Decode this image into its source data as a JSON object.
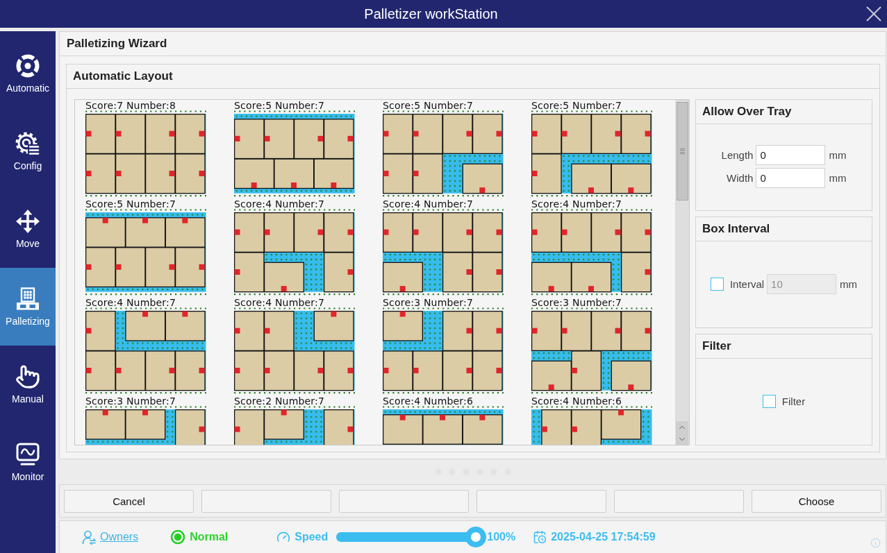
{
  "window": {
    "title": "Palletizer workStation"
  },
  "sidebar": {
    "items": [
      {
        "label": "Automatic",
        "selected": false
      },
      {
        "label": "Config",
        "selected": false
      },
      {
        "label": "Move",
        "selected": false
      },
      {
        "label": "Palletizing",
        "selected": true
      },
      {
        "label": "Manual",
        "selected": false
      },
      {
        "label": "Monitor",
        "selected": false
      }
    ]
  },
  "wizard": {
    "title": "Palletizing Wizard",
    "section": "Automatic Layout",
    "layouts": [
      {
        "label": "Score:7 Number:8"
      },
      {
        "label": "Score:5 Number:7"
      },
      {
        "label": "Score:5 Number:7"
      },
      {
        "label": "Score:5 Number:7"
      },
      {
        "label": "Score:5 Number:7"
      },
      {
        "label": "Score:4 Number:7"
      },
      {
        "label": "Score:4 Number:7"
      },
      {
        "label": "Score:4 Number:7"
      },
      {
        "label": "Score:4 Number:7"
      },
      {
        "label": "Score:4 Number:7"
      },
      {
        "label": "Score:3 Number:7"
      },
      {
        "label": "Score:3 Number:7"
      },
      {
        "label": "Score:3 Number:7"
      },
      {
        "label": "Score:2 Number:7"
      },
      {
        "label": "Score:4 Number:6"
      },
      {
        "label": "Score:4 Number:6"
      }
    ]
  },
  "settings": {
    "allow_over_tray": {
      "title": "Allow Over Tray",
      "fields": [
        {
          "label": "Length",
          "value": "0",
          "unit": "mm"
        },
        {
          "label": "Width",
          "value": "0",
          "unit": "mm"
        }
      ]
    },
    "box_interval": {
      "title": "Box Interval",
      "checked": false,
      "label": "Interval",
      "value": "10",
      "unit": "mm",
      "disabled": true
    },
    "filter": {
      "title": "Filter",
      "checked": false,
      "label": "Filter"
    }
  },
  "buttons": [
    {
      "kind": "labeled",
      "label": "Cancel"
    },
    {
      "kind": "blank"
    },
    {
      "kind": "blank"
    },
    {
      "kind": "blank"
    },
    {
      "kind": "blank"
    },
    {
      "kind": "labeled",
      "label": "Choose"
    }
  ],
  "status_bar": {
    "user": "Owners",
    "status": "Normal",
    "speed": {
      "label": "Speed",
      "level": 1,
      "reading": "100%"
    },
    "datetime": "2025-04-25 17:54:59"
  }
}
